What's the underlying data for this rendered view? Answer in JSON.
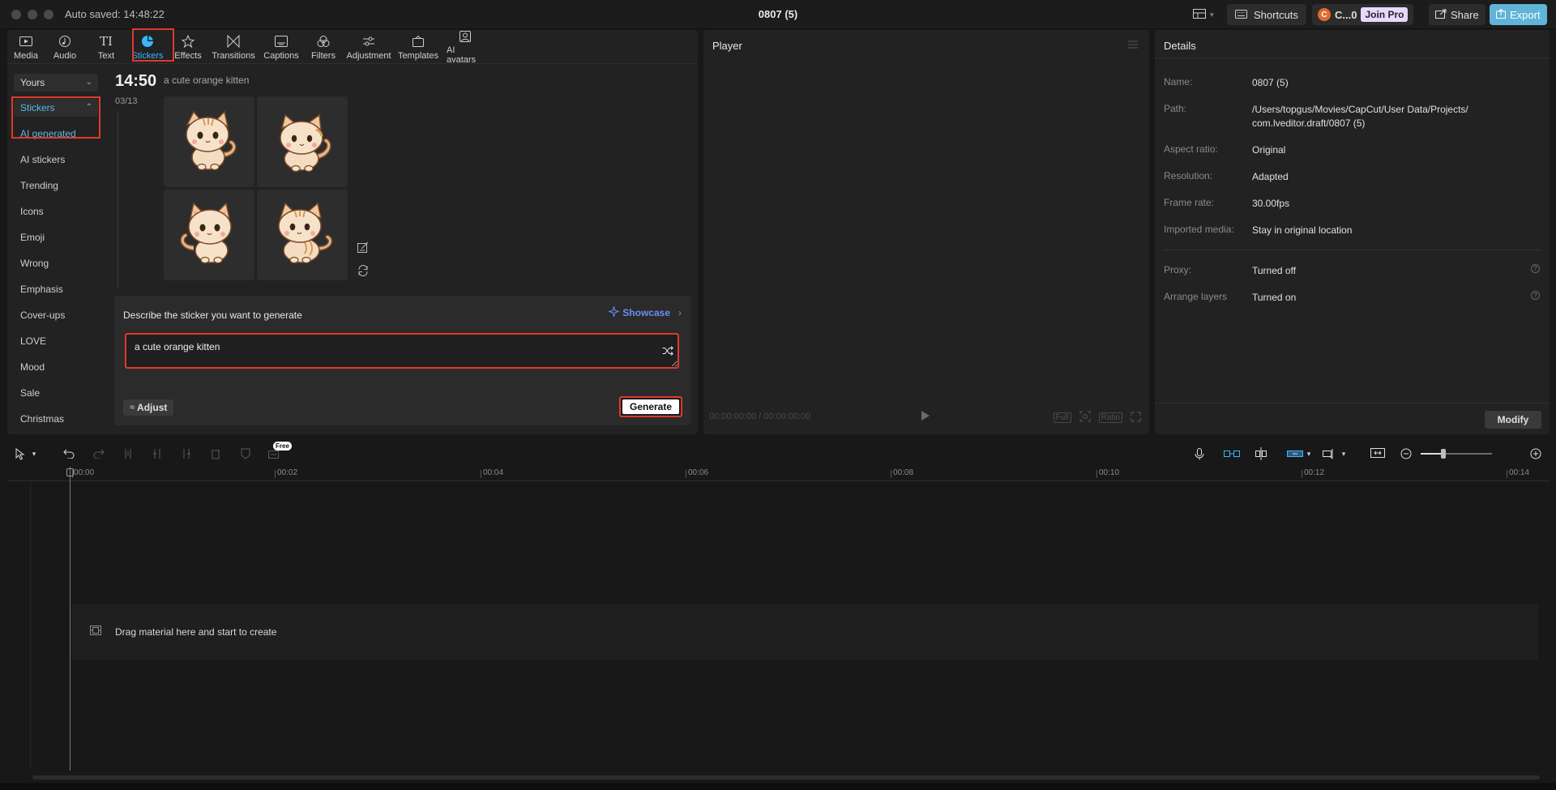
{
  "titlebar": {
    "autosave": "Auto saved: 14:48:22",
    "project_title": "0807 (5)",
    "shortcuts": "Shortcuts",
    "account": "C...0",
    "account_initial": "C",
    "join_pro": "Join Pro",
    "share": "Share",
    "export": "Export"
  },
  "tabs": [
    {
      "label": "Media",
      "icon": "media-icon"
    },
    {
      "label": "Audio",
      "icon": "audio-icon"
    },
    {
      "label": "Text",
      "icon": "text-icon"
    },
    {
      "label": "Stickers",
      "icon": "stickers-icon",
      "active": true
    },
    {
      "label": "Effects",
      "icon": "effects-icon"
    },
    {
      "label": "Transitions",
      "icon": "transitions-icon"
    },
    {
      "label": "Captions",
      "icon": "captions-icon"
    },
    {
      "label": "Filters",
      "icon": "filters-icon"
    },
    {
      "label": "Adjustment",
      "icon": "adjustment-icon"
    },
    {
      "label": "Templates",
      "icon": "templates-icon"
    },
    {
      "label": "AI avatars",
      "icon": "ai-avatars-icon"
    }
  ],
  "sidebar": {
    "yours": "Yours",
    "stickers_header": "Stickers",
    "items": [
      "AI generated",
      "AI stickers",
      "Trending",
      "Icons",
      "Emoji",
      "Wrong",
      "Emphasis",
      "Cover-ups",
      "LOVE",
      "Mood",
      "Sale",
      "Christmas"
    ]
  },
  "generation": {
    "time": "14:50",
    "date": "03/13",
    "prompt_echo": "a cute orange kitten"
  },
  "generator": {
    "label": "Describe the sticker you want to generate",
    "showcase": "Showcase",
    "prompt_value": "a cute orange kitten",
    "adjust": "Adjust",
    "generate": "Generate"
  },
  "player": {
    "title": "Player",
    "time": "00:00:00:00 / 00:00:00:00",
    "full": "Full",
    "ratio": "Ratio"
  },
  "details": {
    "title": "Details",
    "rows": [
      {
        "label": "Name:",
        "value": "0807 (5)"
      },
      {
        "label": "Path:",
        "value": "/Users/topgus/Movies/CapCut/User Data/Projects/ com.lveditor.draft/0807 (5)"
      },
      {
        "label": "Aspect ratio:",
        "value": "Original"
      },
      {
        "label": "Resolution:",
        "value": "Adapted"
      },
      {
        "label": "Frame rate:",
        "value": "30.00fps"
      },
      {
        "label": "Imported media:",
        "value": "Stay in original location"
      },
      {
        "label": "Proxy:",
        "value": "Turned off"
      },
      {
        "label": "Arrange layers",
        "value": "Turned on"
      }
    ],
    "modify": "Modify"
  },
  "timeline": {
    "free_badge": "Free",
    "ticks": [
      "00:00",
      "00:02",
      "00:04",
      "00:06",
      "00:08",
      "00:10",
      "00:12",
      "00:14"
    ],
    "dropzone": "Drag material here and start to create"
  },
  "colors": {
    "accent": "#38b6ff",
    "highlight": "#e0392b",
    "export": "#5fb4d8",
    "showcase": "#6a8ff7"
  }
}
